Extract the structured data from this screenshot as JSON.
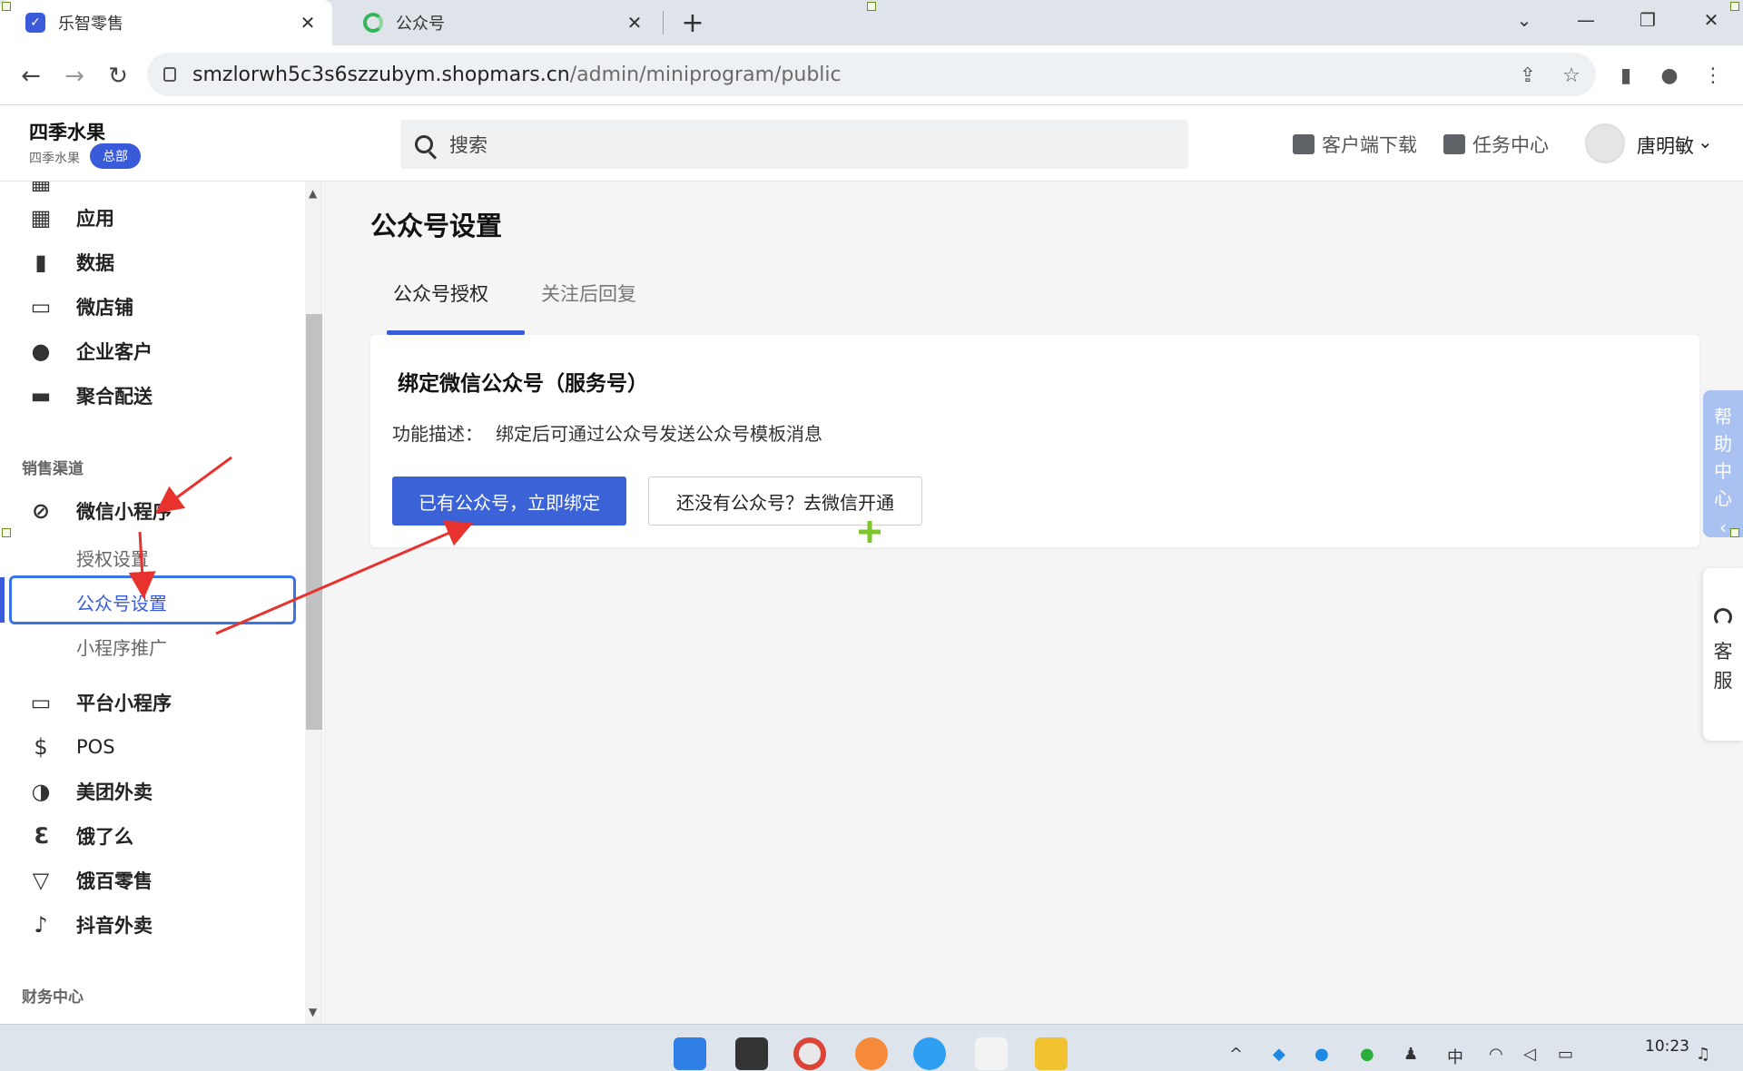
{
  "browser": {
    "tabs": [
      {
        "title": "乐智零售",
        "active": true
      },
      {
        "title": "公众号",
        "active": false
      }
    ],
    "url_host": "smzlorwh5c3s6szzubym.shopmars.cn",
    "url_path": "/admin/miniprogram/public"
  },
  "header": {
    "brand_name": "四季水果",
    "brand_sub": "四季水果",
    "brand_badge": "总部",
    "search_placeholder": "搜索",
    "download_label": "客户端下载",
    "task_label": "任务中心",
    "username": "唐明敏"
  },
  "sidebar": {
    "top_items": [
      {
        "label": "应用",
        "icon": "apps-icon"
      },
      {
        "label": "数据",
        "icon": "bar-chart-icon"
      },
      {
        "label": "微店铺",
        "icon": "store-icon"
      },
      {
        "label": "企业客户",
        "icon": "user-icon"
      },
      {
        "label": "聚合配送",
        "icon": "monitor-icon"
      }
    ],
    "section_sales": "销售渠道",
    "wechat_mini": "微信小程序",
    "sub_items": [
      {
        "label": "授权设置",
        "active": false
      },
      {
        "label": "公众号设置",
        "active": true
      },
      {
        "label": "小程序推广",
        "active": false
      }
    ],
    "channel_items": [
      {
        "label": "平台小程序",
        "icon": "platform-icon"
      },
      {
        "label": "POS",
        "icon": "pos-bag-icon"
      },
      {
        "label": "美团外卖",
        "icon": "meituan-icon"
      },
      {
        "label": "饿了么",
        "icon": "eleme-icon"
      },
      {
        "label": "饿百零售",
        "icon": "basket-icon"
      },
      {
        "label": "抖音外卖",
        "icon": "tiktok-icon"
      }
    ],
    "section_finance": "财务中心"
  },
  "main": {
    "page_title": "公众号设置",
    "tabs": [
      {
        "label": "公众号授权",
        "active": true
      },
      {
        "label": "关注后回复",
        "active": false
      }
    ],
    "card": {
      "title": "绑定微信公众号（服务号）",
      "desc_label": "功能描述：",
      "desc_text": "绑定后可通过公众号发送公众号模板消息",
      "primary_button": "已有公众号，立即绑定",
      "secondary_button": "还没有公众号？去微信开通"
    }
  },
  "floating": {
    "help": [
      "帮",
      "助",
      "中",
      "心"
    ],
    "cs": [
      "客",
      "服"
    ]
  },
  "taskbar": {
    "time": "10:23",
    "ime": "中"
  },
  "colors": {
    "accent": "#3a5bd9",
    "annotation_red": "#e8322d"
  }
}
